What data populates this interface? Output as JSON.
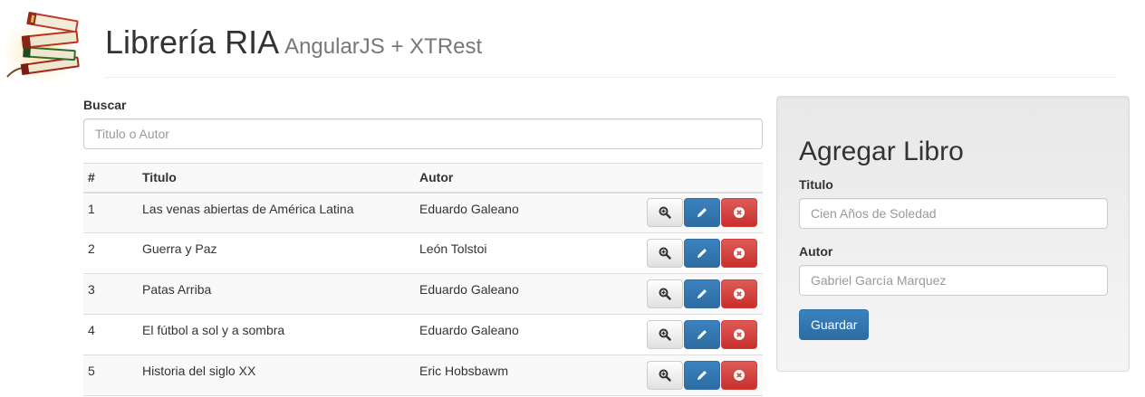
{
  "header": {
    "logo_icon": "stacked-books-icon",
    "title": "Librería RIA",
    "subtitle": "AngularJS + XTRest"
  },
  "search": {
    "label": "Buscar",
    "placeholder": "Titulo o Autor",
    "value": ""
  },
  "table": {
    "columns": [
      "#",
      "Titulo",
      "Autor",
      ""
    ],
    "rows": [
      {
        "num": "1",
        "title": "Las venas abiertas de América Latina",
        "author": "Eduardo Galeano"
      },
      {
        "num": "2",
        "title": "Guerra y Paz",
        "author": "León Tolstoi"
      },
      {
        "num": "3",
        "title": "Patas Arriba",
        "author": "Eduardo Galeano"
      },
      {
        "num": "4",
        "title": "El fútbol a sol y a sombra",
        "author": "Eduardo Galeano"
      },
      {
        "num": "5",
        "title": "Historia del siglo XX",
        "author": "Eric Hobsbawm"
      }
    ],
    "row_actions": [
      {
        "name": "view",
        "icon": "zoom-in-icon"
      },
      {
        "name": "edit",
        "icon": "pencil-icon"
      },
      {
        "name": "delete",
        "icon": "remove-circle-icon"
      }
    ]
  },
  "add_form": {
    "title": "Agregar Libro",
    "title_label": "Titulo",
    "title_placeholder": "Cien Años de Soledad",
    "author_label": "Autor",
    "author_placeholder": "Gabriel García Marquez",
    "submit_label": "Guardar"
  },
  "colors": {
    "primary": "#337ab7",
    "danger": "#d9534f",
    "default": "#e0e0e0",
    "panel_bg": "#ebebeb"
  }
}
